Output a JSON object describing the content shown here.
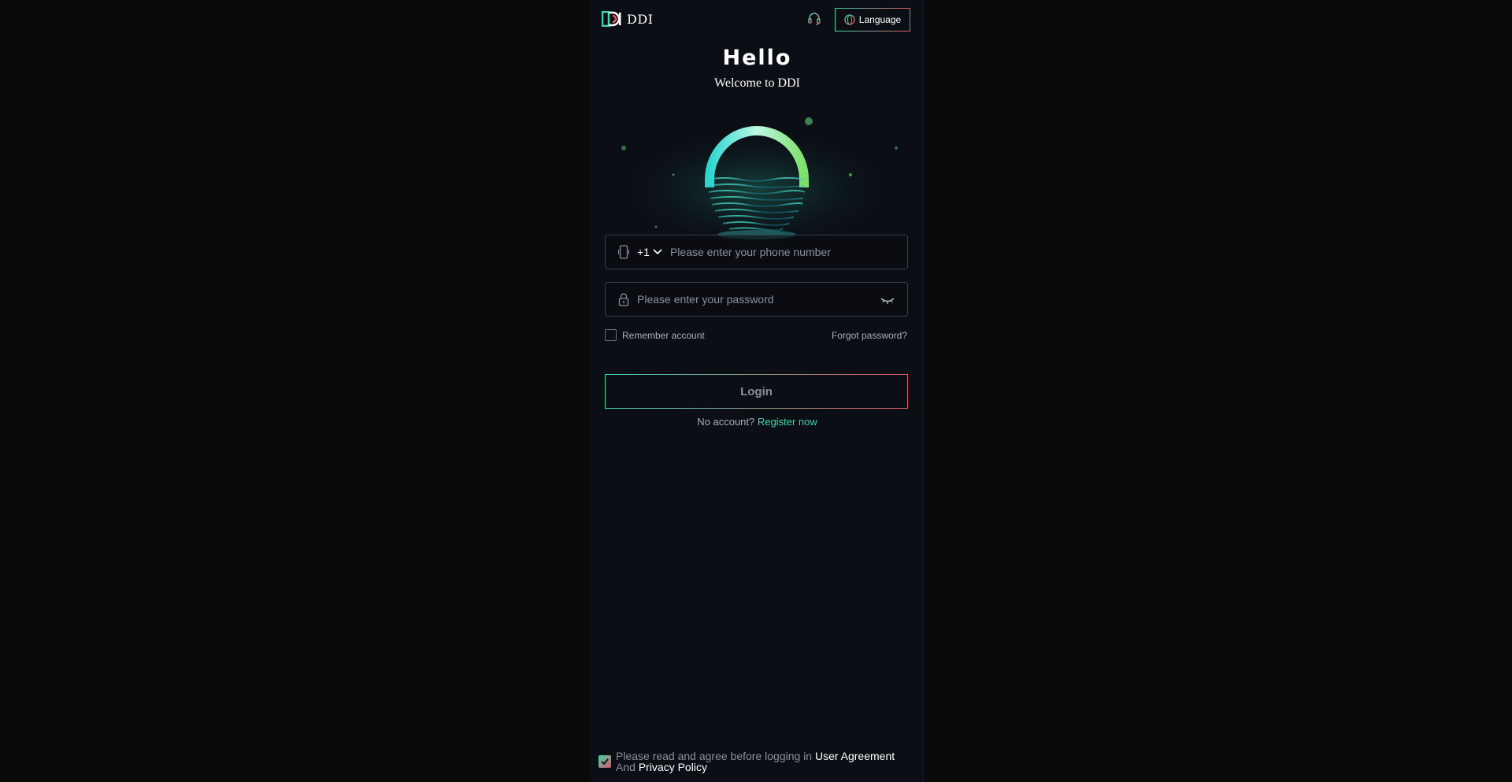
{
  "header": {
    "brand_name": "DDI",
    "language_label": "Language"
  },
  "intro": {
    "hello": "Hello",
    "welcome": "Welcome to DDI"
  },
  "form": {
    "country_code": "+1",
    "phone_placeholder": "Please enter your phone number",
    "password_placeholder": "Please enter your password",
    "remember_label": "Remember account",
    "forgot_label": "Forgot password?",
    "login_label": "Login",
    "no_account_text": "No account?",
    "register_label": "Register now"
  },
  "agreement": {
    "prefix": "Please read and agree before logging in",
    "user_agreement": "User Agreement",
    "and": "And",
    "privacy_policy": "Privacy Policy",
    "checked": true
  },
  "colors": {
    "accent_green": "#3fd6a8",
    "accent_red": "#e0566a",
    "background": "#0b0e14"
  },
  "icons": [
    "ddi-logo-icon",
    "headset-icon",
    "globe-icon",
    "phone-icon",
    "chevron-down-icon",
    "lock-icon",
    "eye-closed-icon",
    "checkmark-icon"
  ]
}
